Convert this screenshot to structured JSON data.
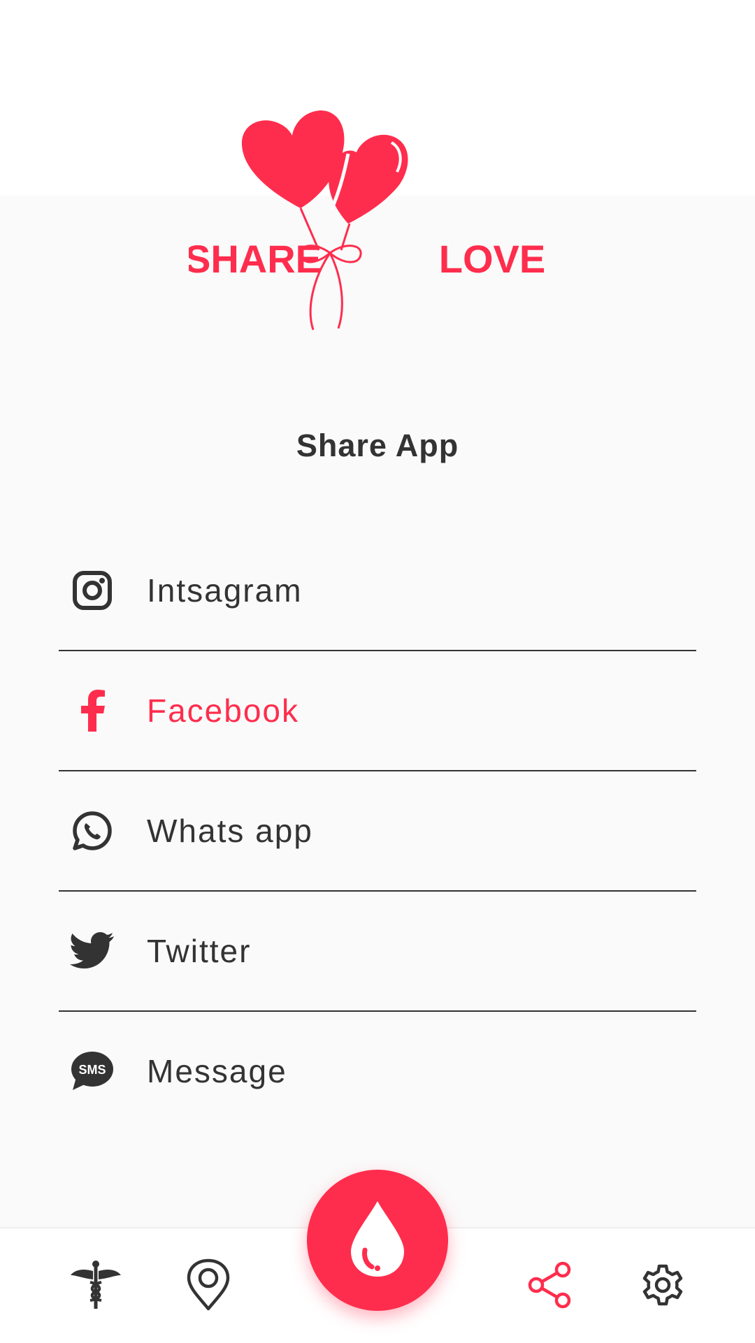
{
  "colors": {
    "accent": "#ff2d4d",
    "text": "#333333",
    "background": "#fafafa"
  },
  "logo": {
    "word_left": "SHARE",
    "word_right": "LOVE",
    "icon": "heart-balloons-icon"
  },
  "page_title": "Share App",
  "share_options": [
    {
      "label": "Intsagram",
      "icon": "instagram-icon",
      "active": false
    },
    {
      "label": "Facebook",
      "icon": "facebook-icon",
      "active": true
    },
    {
      "label": "Whats app",
      "icon": "whatsapp-icon",
      "active": false
    },
    {
      "label": "Twitter",
      "icon": "twitter-icon",
      "active": false
    },
    {
      "label": "Message",
      "icon": "sms-icon",
      "active": false
    }
  ],
  "bottom_nav": {
    "items": [
      {
        "icon": "caduceus-icon",
        "active": false
      },
      {
        "icon": "location-pin-icon",
        "active": false
      },
      {
        "icon": "share-icon",
        "active": true
      },
      {
        "icon": "gear-icon",
        "active": false
      }
    ],
    "fab": {
      "icon": "blood-drop-icon"
    }
  },
  "sms_icon_text": "SMS"
}
